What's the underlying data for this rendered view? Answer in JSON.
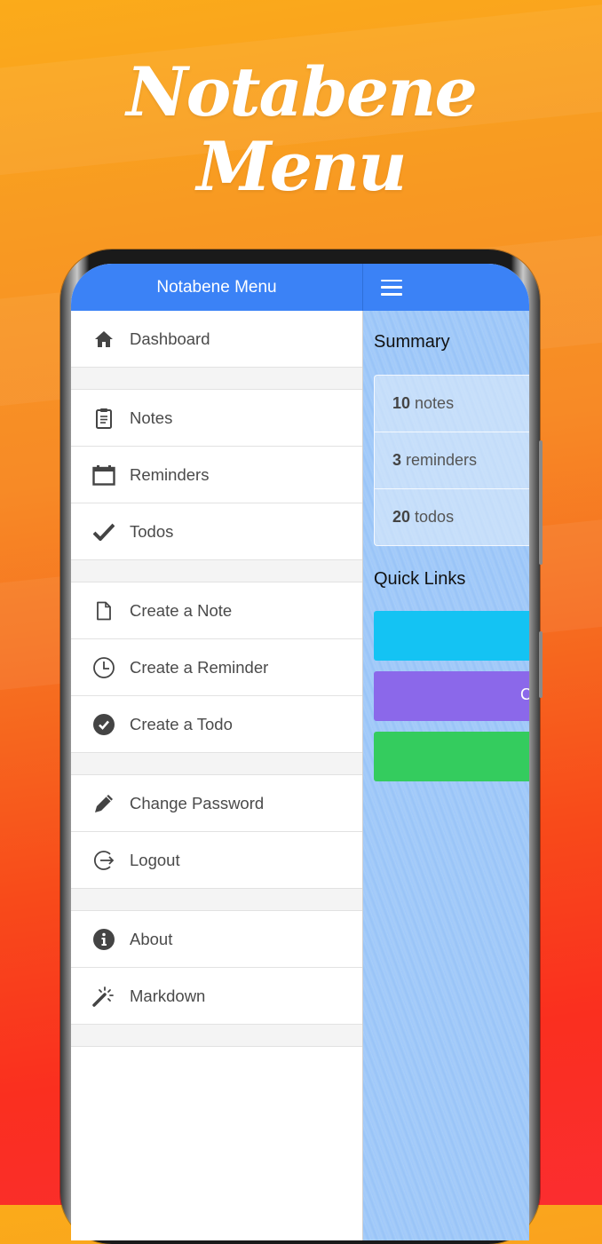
{
  "promo": {
    "title_line1": "Notabene",
    "title_line2": "Menu"
  },
  "app": {
    "header_title": "Notabene Menu",
    "menu_toggle_icon": "hamburger-icon"
  },
  "menu": {
    "groups": [
      [
        {
          "label": "Dashboard",
          "icon": "home-icon"
        }
      ],
      [
        {
          "label": "Notes",
          "icon": "clipboard-icon"
        },
        {
          "label": "Reminders",
          "icon": "calendar-icon"
        },
        {
          "label": "Todos",
          "icon": "check-icon"
        }
      ],
      [
        {
          "label": "Create a Note",
          "icon": "file-icon"
        },
        {
          "label": "Create a Reminder",
          "icon": "clock-icon"
        },
        {
          "label": "Create a Todo",
          "icon": "check-circle-icon"
        }
      ],
      [
        {
          "label": "Change Password",
          "icon": "pencil-icon"
        },
        {
          "label": "Logout",
          "icon": "logout-icon"
        }
      ],
      [
        {
          "label": "About",
          "icon": "info-icon"
        },
        {
          "label": "Markdown",
          "icon": "magic-wand-icon"
        }
      ]
    ]
  },
  "summary": {
    "title": "Summary",
    "rows": [
      {
        "count": "10",
        "label": "notes"
      },
      {
        "count": "3",
        "label": "reminders"
      },
      {
        "count": "20",
        "label": "todos"
      }
    ]
  },
  "quick_links": {
    "title": "Quick Links",
    "buttons": [
      {
        "label": "",
        "color": "#14c3f3"
      },
      {
        "label": "C",
        "color": "#8b68ea"
      },
      {
        "label": "",
        "color": "#34cc5e"
      }
    ]
  },
  "colors": {
    "header": "#3b82f6",
    "content_bg": "#a0c8f8"
  }
}
